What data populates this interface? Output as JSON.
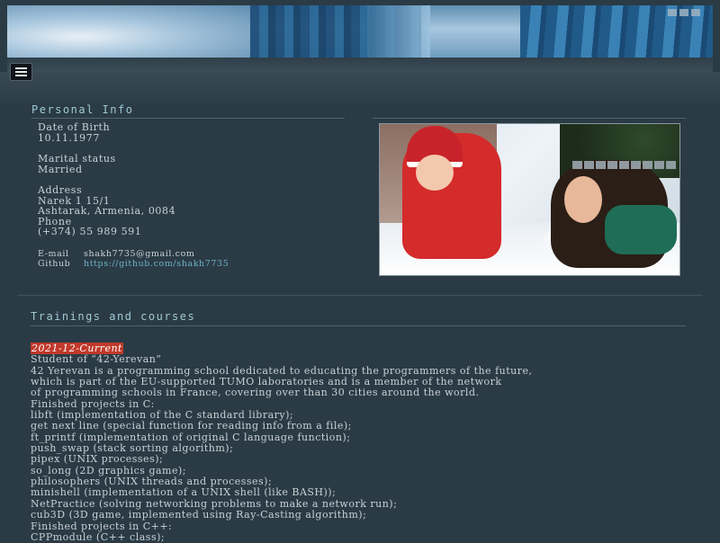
{
  "menu": {
    "icon": "hamburger-icon"
  },
  "personal": {
    "title": "Personal Info",
    "dob_label": "Date of Birth",
    "dob": "10.11.1977",
    "marital_label": "Marital status",
    "marital": "Married",
    "address_label": "Address",
    "address_line1": "Narek 1 15/1",
    "address_line2": "Ashtarak, Armenia, 0084",
    "phone_label": "Phone",
    "phone": "(+374) 55 989 591",
    "email_label": "E-mail",
    "email": "shakh7735@gmail.com",
    "github_label": "Github",
    "github": "https://github.com/shakh7735"
  },
  "trainings": {
    "title": "Trainings and courses",
    "date": "2021-12-Current",
    "lines": [
      "Student of “42-Yerevan”",
      "42 Yerevan is a programming school dedicated to educating the programmers of the future,",
      "which is part of the EU-supported TUMO laboratories and is a member of the network",
      "of programming schools in France, covering over than 30 cities around the world.",
      "Finished projects in C:",
      "libft (implementation of the C standard library);",
      "get next line (special function for reading info from a file);",
      "ft_printf (implementation of original C language function);",
      "push_swap (stack sorting algorithm);",
      "pipex (UNIX processes);",
      "so_long (2D graphics game);",
      "philosophers (UNIX threads and processes);",
      "minishell (implementation of a UNIX shell (like BASH));",
      "NetPractice (solving networking problems to make a network run);",
      "cub3D (3D game, implemented using Ray-Casting algorithm);",
      "Finished projects in C++:",
      "CPPmodule (C++ class);"
    ]
  }
}
